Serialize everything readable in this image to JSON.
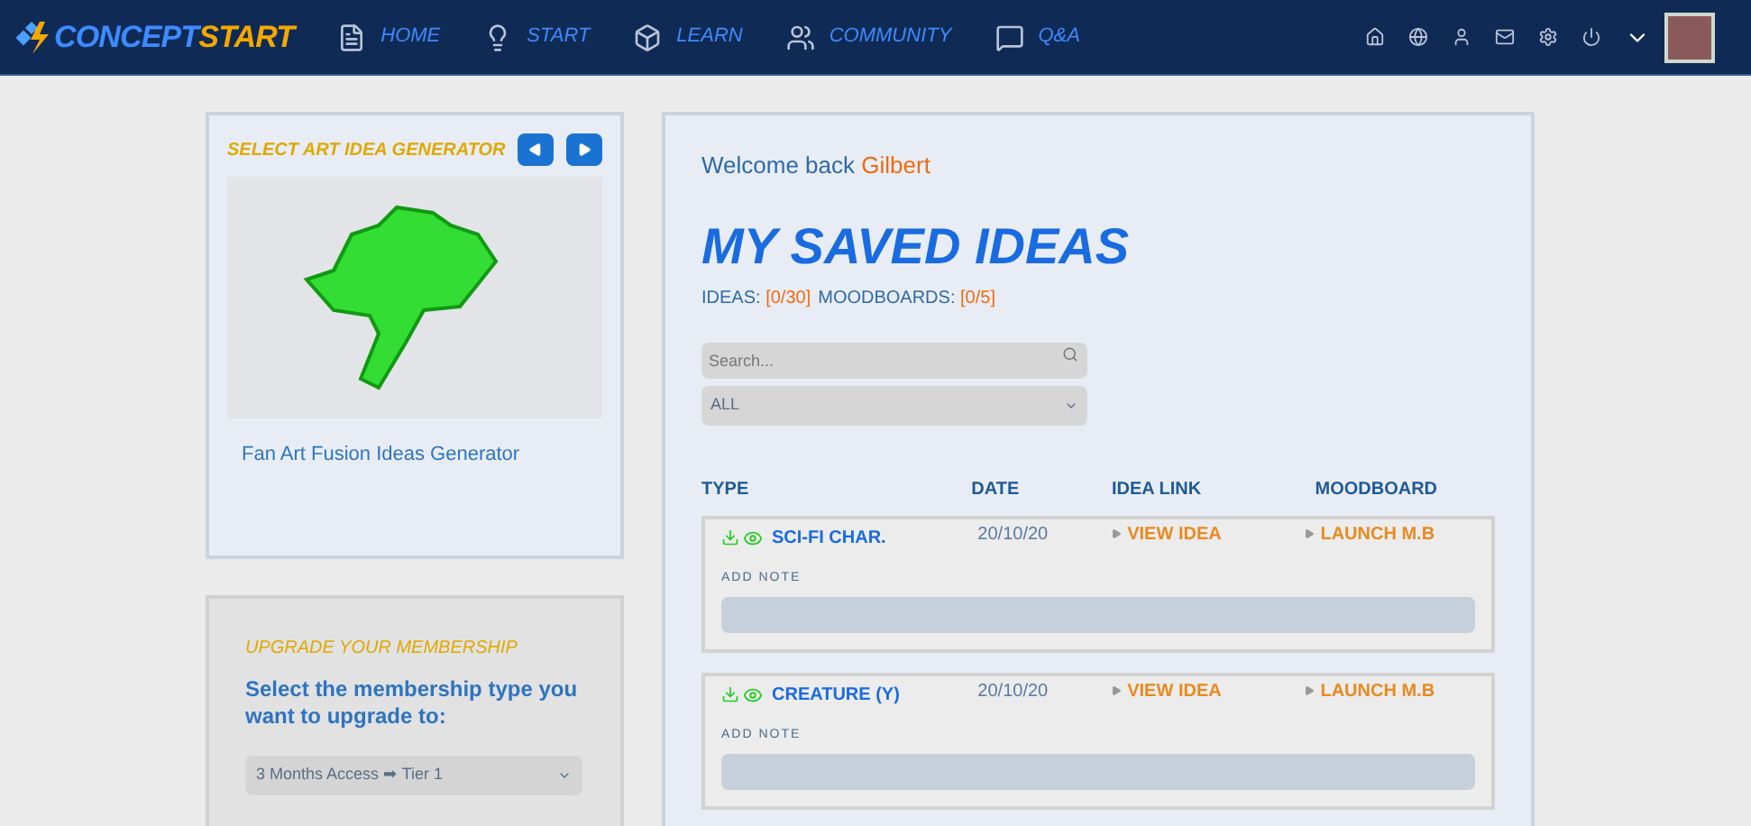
{
  "logo": {
    "part_1": "CONCEPT",
    "part_2": "START"
  },
  "nav": [
    {
      "label": "HOME"
    },
    {
      "label": "START"
    },
    {
      "label": "LEARN"
    },
    {
      "label": "COMMUNITY"
    },
    {
      "label": "Q&A"
    }
  ],
  "generator": {
    "title": "SELECT ART IDEA GENERATOR",
    "caption": "Fan Art Fusion Ideas Generator"
  },
  "membership": {
    "title": "UPGRADE YOUR MEMBERSHIP",
    "prompt": "Select the membership type you want to upgrade to:",
    "select_value": "3 Months Access ➡ Tier 1"
  },
  "welcome": {
    "text": "Welcome back",
    "name": "Gilbert"
  },
  "heading": "MY SAVED IDEAS",
  "counts": [
    {
      "label": "IDEAS:",
      "value": "[0/30]"
    },
    {
      "label": "MOODBOARDS:",
      "value": "[0/5]"
    }
  ],
  "search": {
    "placeholder": "Search..."
  },
  "filter": {
    "value": "ALL"
  },
  "table": {
    "columns": [
      "TYPE",
      "DATE",
      "IDEA LINK",
      "MOODBOARD"
    ],
    "rows": [
      {
        "type": "SCI-FI CHAR.",
        "date": "20/10/20",
        "link": "VIEW IDEA",
        "moodboard": "LAUNCH M.B",
        "note_label": "ADD NOTE"
      },
      {
        "type": "CREATURE (Y)",
        "date": "20/10/20",
        "link": "VIEW IDEA",
        "moodboard": "LAUNCH M.B",
        "note_label": "ADD NOTE"
      }
    ]
  }
}
